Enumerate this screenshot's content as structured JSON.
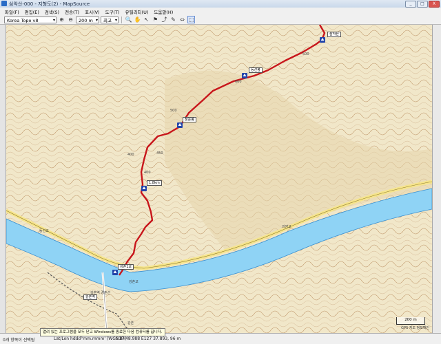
{
  "window": {
    "title": "삼악산-000 - 지형도(2) - MapSource",
    "buttons": {
      "minimize": "_",
      "maximize": "□",
      "close": "X"
    }
  },
  "menu": [
    "파일(F)",
    "편집(E)",
    "검색(S)",
    "전송(T)",
    "표시(V)",
    "도구(T)",
    "유틸리티(U)",
    "도움말(H)"
  ],
  "toolbar": {
    "map_product": "Korea Topo v8",
    "zoom": "200 m",
    "detail": "최고"
  },
  "map": {
    "waypoints": [
      "삼악산",
      "등선봉",
      "강촌1교",
      "청운봉",
      "강촌역",
      "1.8km"
    ],
    "contour_labels": [
      "500",
      "600",
      "500",
      "450",
      "400",
      "400"
    ],
    "place_labels": [
      "강촌역 경춘선",
      "등선교",
      "강촌교",
      "의암교",
      "강촌"
    ],
    "route_color": "#c8161b",
    "river_color": "#8fd3f5",
    "road_color": "#f6e58a",
    "scale": "200 m",
    "scale_note": "GPS 지도 정보확인"
  },
  "tooltip": "열려 있는 프로그램을 모두 닫고 Windows를 종료한 다음 컴퓨터를 끕니다.",
  "status": {
    "selection": "0개 항목이 선택됨",
    "format": "Lat/Lon hddd°mm.mmm' (WGS 84)",
    "coords": "N37 48.988 E127 37.893, 96 m"
  }
}
